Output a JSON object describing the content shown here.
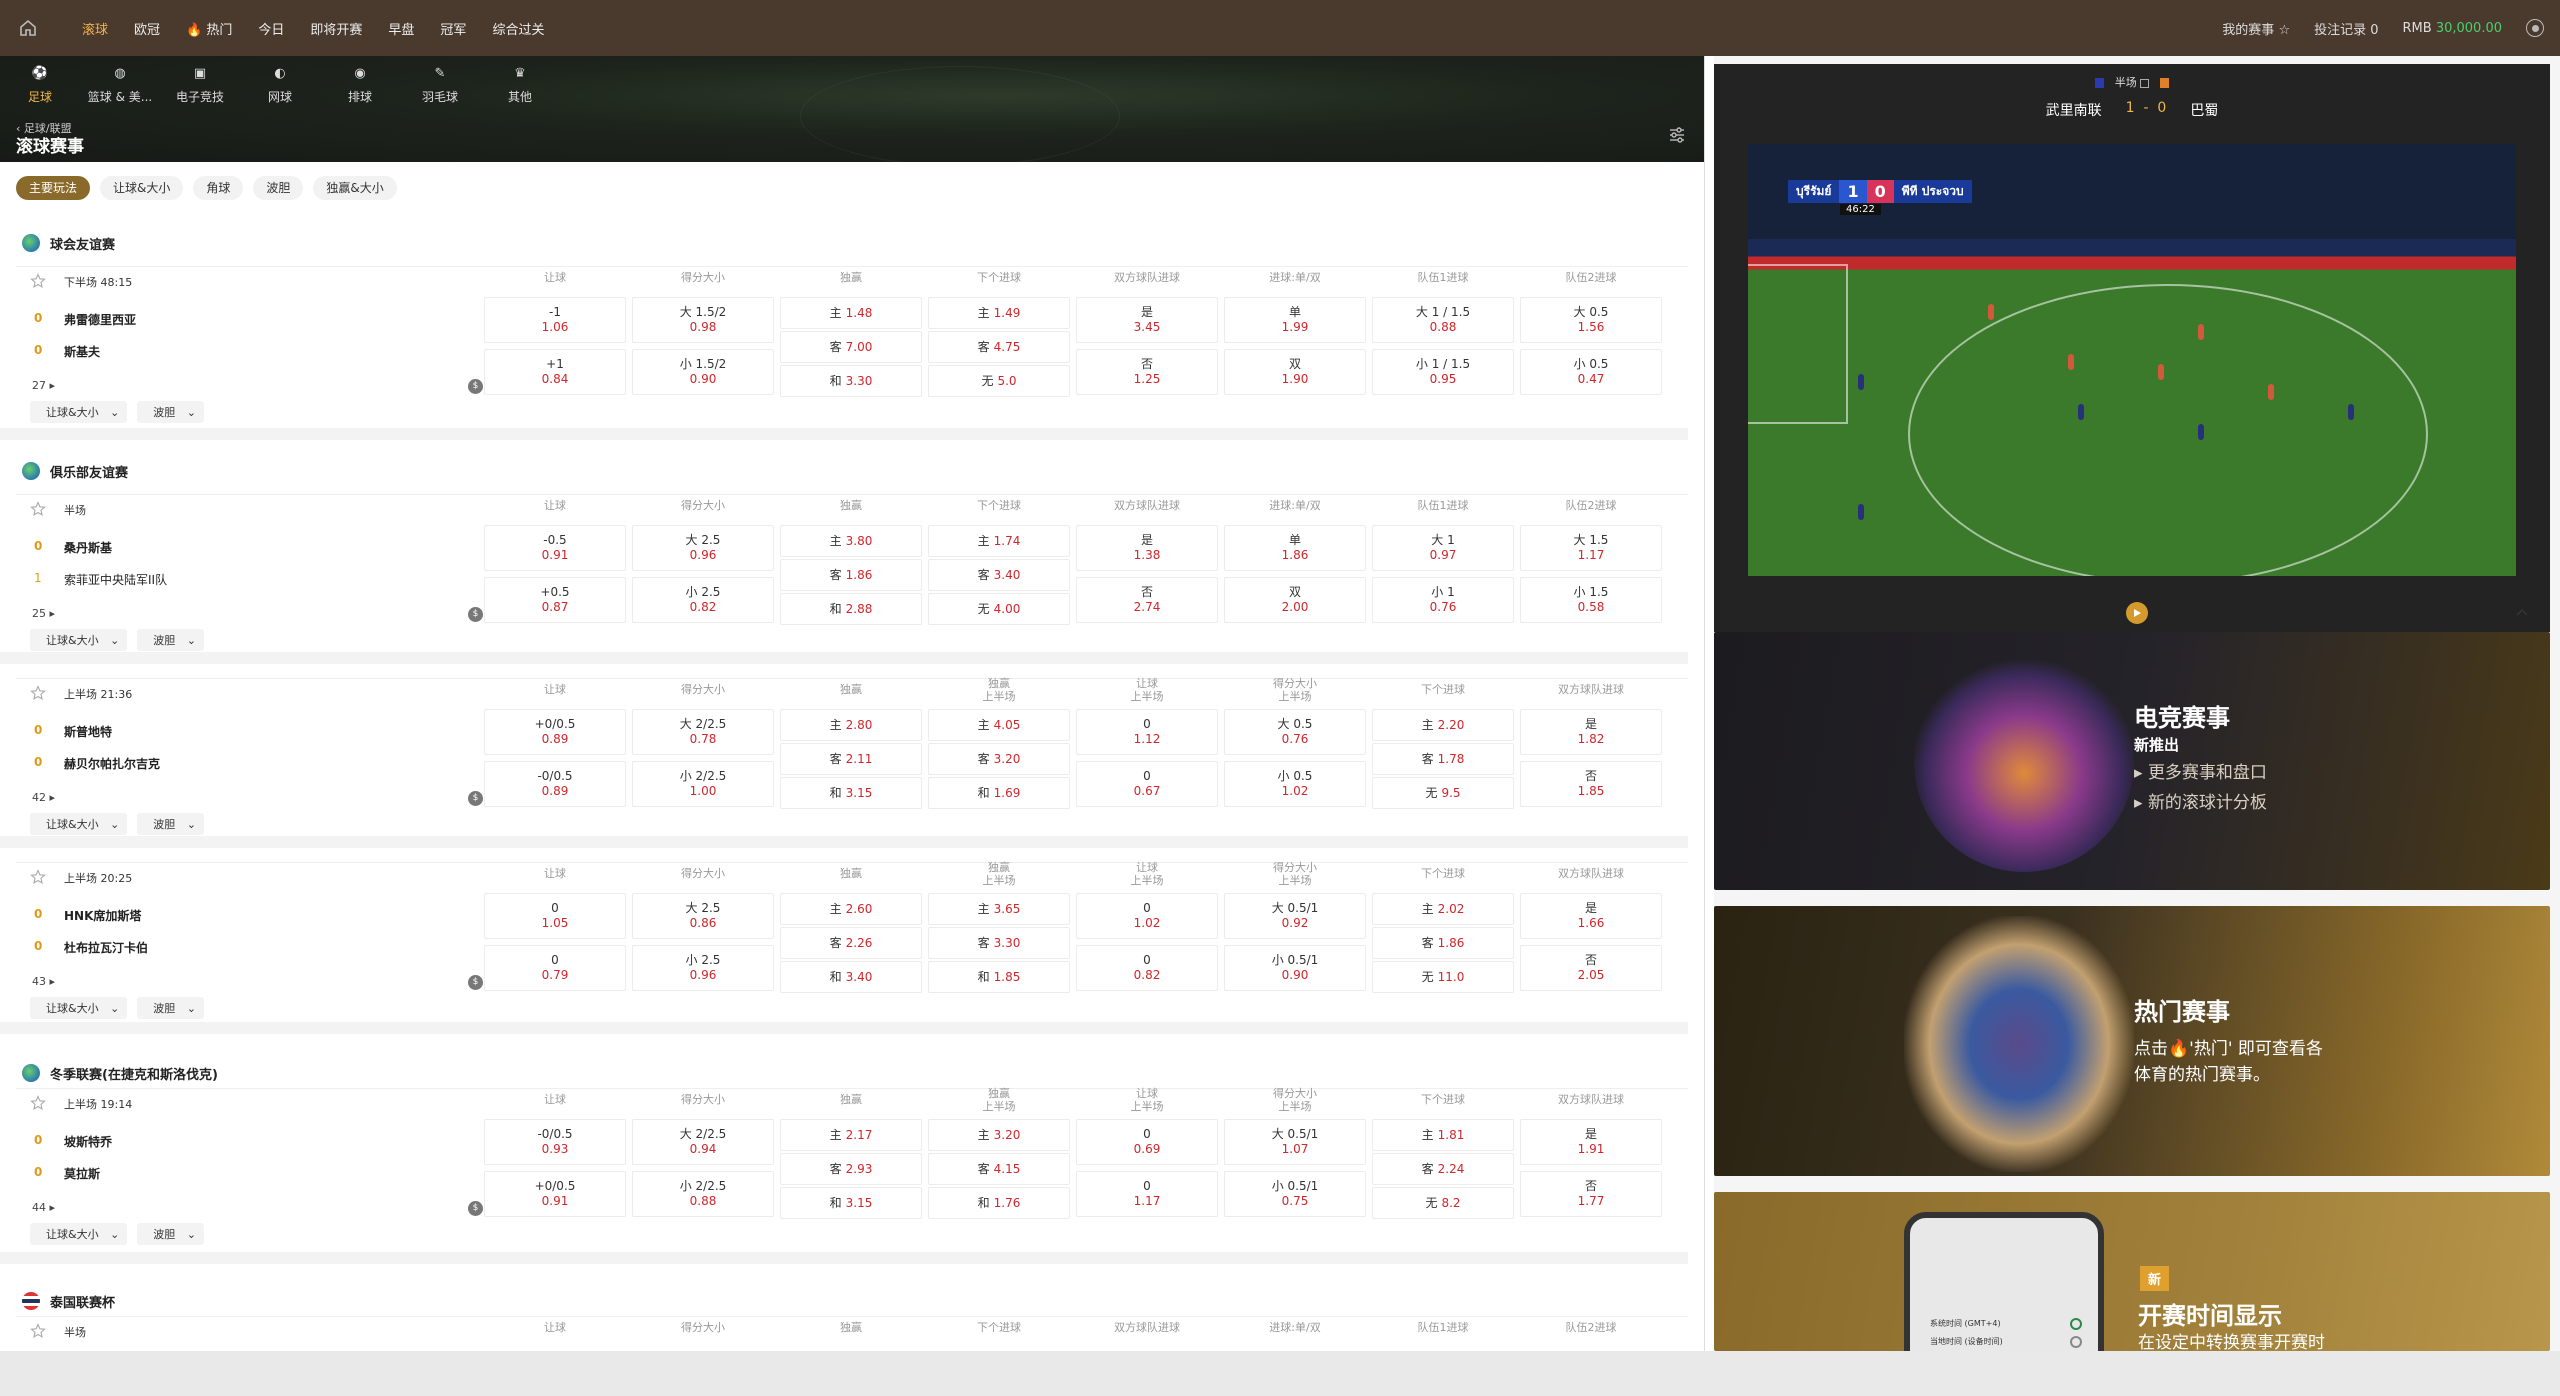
{
  "nav": {
    "tabs": [
      "滚球",
      "欧冠",
      "热门",
      "今日",
      "即将开赛",
      "早盘",
      "冠军",
      "综合过关"
    ],
    "active": "滚球",
    "right": {
      "my_events": "我的赛事",
      "bet_records": "投注记录 0",
      "currency": "RMB",
      "balance": "30,000.00"
    }
  },
  "sports": [
    {
      "label": "足球",
      "icon": "soccer-icon"
    },
    {
      "label": "篮球 & 美...",
      "icon": "basketball-icon"
    },
    {
      "label": "电子竞技",
      "icon": "esports-icon"
    },
    {
      "label": "网球",
      "icon": "tennis-icon"
    },
    {
      "label": "排球",
      "icon": "volleyball-icon"
    },
    {
      "label": "羽毛球",
      "icon": "badminton-icon"
    },
    {
      "label": "其他",
      "icon": "other-icon"
    }
  ],
  "breadcrumb": "足球/联盟",
  "page_title": "滚球赛事",
  "market_tabs": [
    "主要玩法",
    "让球&大小",
    "角球",
    "波胆",
    "独赢&大小"
  ],
  "opt_labels": {
    "handicap_ou": "让球&大小",
    "correct_score": "波胆"
  },
  "leagues": [
    {
      "name": "球会友谊赛",
      "flag": "globe"
    },
    {
      "name": "俱乐部友谊赛",
      "flag": "globe"
    },
    {
      "name": "冬季联赛(在捷克和斯洛伐克)",
      "flag": "globe"
    },
    {
      "name": "泰国联赛杯",
      "flag": "thailand"
    }
  ],
  "matches": [
    {
      "time": "下半场  48:15",
      "more": "27",
      "home": {
        "score": "0",
        "name": "弗雷德里西亚"
      },
      "away": {
        "score": "0",
        "name": "斯基夫"
      },
      "headers": [
        "让球",
        "得分大小",
        "独赢",
        "下个进球",
        "双方球队进球",
        "进球:单/双",
        "队伍1进球",
        "队伍2进球"
      ],
      "cols": [
        [
          [
            "-1",
            "1.06"
          ],
          [
            "+1",
            "0.84"
          ]
        ],
        [
          [
            "大 1.5/2",
            "0.98"
          ],
          [
            "小 1.5/2",
            "0.90"
          ]
        ],
        [
          [
            "主",
            "1.48"
          ],
          [
            "客",
            "7.00"
          ],
          [
            "和",
            "3.30"
          ]
        ],
        [
          [
            "主",
            "1.49"
          ],
          [
            "客",
            "4.75"
          ],
          [
            "无",
            "5.0"
          ]
        ],
        [
          [
            "是",
            "3.45"
          ],
          [
            "否",
            "1.25"
          ]
        ],
        [
          [
            "单",
            "1.99"
          ],
          [
            "双",
            "1.90"
          ]
        ],
        [
          [
            "大 1 / 1.5",
            "0.88"
          ],
          [
            "小 1 / 1.5",
            "0.95"
          ]
        ],
        [
          [
            "大 0.5",
            "1.56"
          ],
          [
            "小 0.5",
            "0.47"
          ]
        ]
      ]
    },
    {
      "time": "半场",
      "more": "25",
      "home": {
        "score": "0",
        "name": "桑丹斯基"
      },
      "away": {
        "score": "1",
        "name": "索菲亚中央陆军II队"
      },
      "headers": [
        "让球",
        "得分大小",
        "独赢",
        "下个进球",
        "双方球队进球",
        "进球:单/双",
        "队伍1进球",
        "队伍2进球"
      ],
      "cols": [
        [
          [
            "-0.5",
            "0.91"
          ],
          [
            "+0.5",
            "0.87"
          ]
        ],
        [
          [
            "大 2.5",
            "0.96"
          ],
          [
            "小 2.5",
            "0.82"
          ]
        ],
        [
          [
            "主",
            "3.80"
          ],
          [
            "客",
            "1.86"
          ],
          [
            "和",
            "2.88"
          ]
        ],
        [
          [
            "主",
            "1.74"
          ],
          [
            "客",
            "3.40"
          ],
          [
            "无",
            "4.00"
          ]
        ],
        [
          [
            "是",
            "1.38"
          ],
          [
            "否",
            "2.74"
          ]
        ],
        [
          [
            "单",
            "1.86"
          ],
          [
            "双",
            "2.00"
          ]
        ],
        [
          [
            "大 1",
            "0.97"
          ],
          [
            "小 1",
            "0.76"
          ]
        ],
        [
          [
            "大 1.5",
            "1.17"
          ],
          [
            "小 1.5",
            "0.58"
          ]
        ]
      ]
    },
    {
      "time": "上半场  21:36",
      "more": "42",
      "home": {
        "score": "0",
        "name": "斯普地特"
      },
      "away": {
        "score": "0",
        "name": "赫贝尔帕扎尔吉克"
      },
      "headers": [
        "让球",
        "得分大小",
        "独赢",
        "独赢\n上半场",
        "让球\n上半场",
        "得分大小\n上半场",
        "下个进球",
        "双方球队进球"
      ],
      "cols": [
        [
          [
            "+0/0.5",
            "0.89"
          ],
          [
            "-0/0.5",
            "0.89"
          ]
        ],
        [
          [
            "大 2/2.5",
            "0.78"
          ],
          [
            "小 2/2.5",
            "1.00"
          ]
        ],
        [
          [
            "主",
            "2.80"
          ],
          [
            "客",
            "2.11"
          ],
          [
            "和",
            "3.15"
          ]
        ],
        [
          [
            "主",
            "4.05"
          ],
          [
            "客",
            "3.20"
          ],
          [
            "和",
            "1.69"
          ]
        ],
        [
          [
            "0",
            "1.12"
          ],
          [
            "0",
            "0.67"
          ]
        ],
        [
          [
            "大 0.5",
            "0.76"
          ],
          [
            "小 0.5",
            "1.02"
          ]
        ],
        [
          [
            "主",
            "2.20"
          ],
          [
            "客",
            "1.78"
          ],
          [
            "无",
            "9.5"
          ]
        ],
        [
          [
            "是",
            "1.82"
          ],
          [
            "否",
            "1.85"
          ]
        ]
      ]
    },
    {
      "time": "上半场  20:25",
      "more": "43",
      "home": {
        "score": "0",
        "name": "HNK席加斯塔"
      },
      "away": {
        "score": "0",
        "name": "杜布拉瓦汀卡伯"
      },
      "headers": [
        "让球",
        "得分大小",
        "独赢",
        "独赢\n上半场",
        "让球\n上半场",
        "得分大小\n上半场",
        "下个进球",
        "双方球队进球"
      ],
      "cols": [
        [
          [
            "0",
            "1.05"
          ],
          [
            "0",
            "0.79"
          ]
        ],
        [
          [
            "大 2.5",
            "0.86"
          ],
          [
            "小 2.5",
            "0.96"
          ]
        ],
        [
          [
            "主",
            "2.60"
          ],
          [
            "客",
            "2.26"
          ],
          [
            "和",
            "3.40"
          ]
        ],
        [
          [
            "主",
            "3.65"
          ],
          [
            "客",
            "3.30"
          ],
          [
            "和",
            "1.85"
          ]
        ],
        [
          [
            "0",
            "1.02"
          ],
          [
            "0",
            "0.82"
          ]
        ],
        [
          [
            "大 0.5/1",
            "0.92"
          ],
          [
            "小 0.5/1",
            "0.90"
          ]
        ],
        [
          [
            "主",
            "2.02"
          ],
          [
            "客",
            "1.86"
          ],
          [
            "无",
            "11.0"
          ]
        ],
        [
          [
            "是",
            "1.66"
          ],
          [
            "否",
            "2.05"
          ]
        ]
      ]
    },
    {
      "time": "上半场  19:14",
      "more": "44",
      "home": {
        "score": "0",
        "name": "坡斯特乔"
      },
      "away": {
        "score": "0",
        "name": "莫拉斯"
      },
      "headers": [
        "让球",
        "得分大小",
        "独赢",
        "独赢\n上半场",
        "让球\n上半场",
        "得分大小\n上半场",
        "下个进球",
        "双方球队进球"
      ],
      "cols": [
        [
          [
            "-0/0.5",
            "0.93"
          ],
          [
            "+0/0.5",
            "0.91"
          ]
        ],
        [
          [
            "大 2/2.5",
            "0.94"
          ],
          [
            "小 2/2.5",
            "0.88"
          ]
        ],
        [
          [
            "主",
            "2.17"
          ],
          [
            "客",
            "2.93"
          ],
          [
            "和",
            "3.15"
          ]
        ],
        [
          [
            "主",
            "3.20"
          ],
          [
            "客",
            "4.15"
          ],
          [
            "和",
            "1.76"
          ]
        ],
        [
          [
            "0",
            "0.69"
          ],
          [
            "0",
            "1.17"
          ]
        ],
        [
          [
            "大 0.5/1",
            "1.07"
          ],
          [
            "小 0.5/1",
            "0.75"
          ]
        ],
        [
          [
            "主",
            "1.81"
          ],
          [
            "客",
            "2.24"
          ],
          [
            "无",
            "8.2"
          ]
        ],
        [
          [
            "是",
            "1.91"
          ],
          [
            "否",
            "1.77"
          ]
        ]
      ]
    },
    {
      "time": "半场",
      "headers": [
        "让球",
        "得分大小",
        "独赢",
        "下个进球",
        "双方球队进球",
        "进球:单/双",
        "队伍1进球",
        "队伍2进球"
      ]
    }
  ],
  "video": {
    "period": "半场",
    "home": "武里南联",
    "away": "巴蜀",
    "score_home": "1",
    "score_away": "0",
    "overlay_home": "บุรีรัมย์",
    "overlay_away": "พีที ประจวบ",
    "overlay_time": "46:22"
  },
  "promos": [
    {
      "title": "电竞赛事",
      "sub": "新推出",
      "bullets": [
        "更多赛事和盘口",
        "新的滚球计分板"
      ]
    },
    {
      "title": "热门赛事",
      "body1": "点击🔥'热门' 即可查看各",
      "body2": "体育的热门赛事。"
    },
    {
      "badge": "新",
      "title": "开赛时间显示",
      "body": "在设定中转换赛事开赛时",
      "phone_lines": [
        "系统时间 (GMT+4)",
        "当地时间 (设备时间)"
      ]
    }
  ],
  "colors": {
    "accent": "#f0b44a",
    "odds": "#d0262b",
    "balance": "#4ccf6a",
    "topbar": "#4a3a2e"
  }
}
